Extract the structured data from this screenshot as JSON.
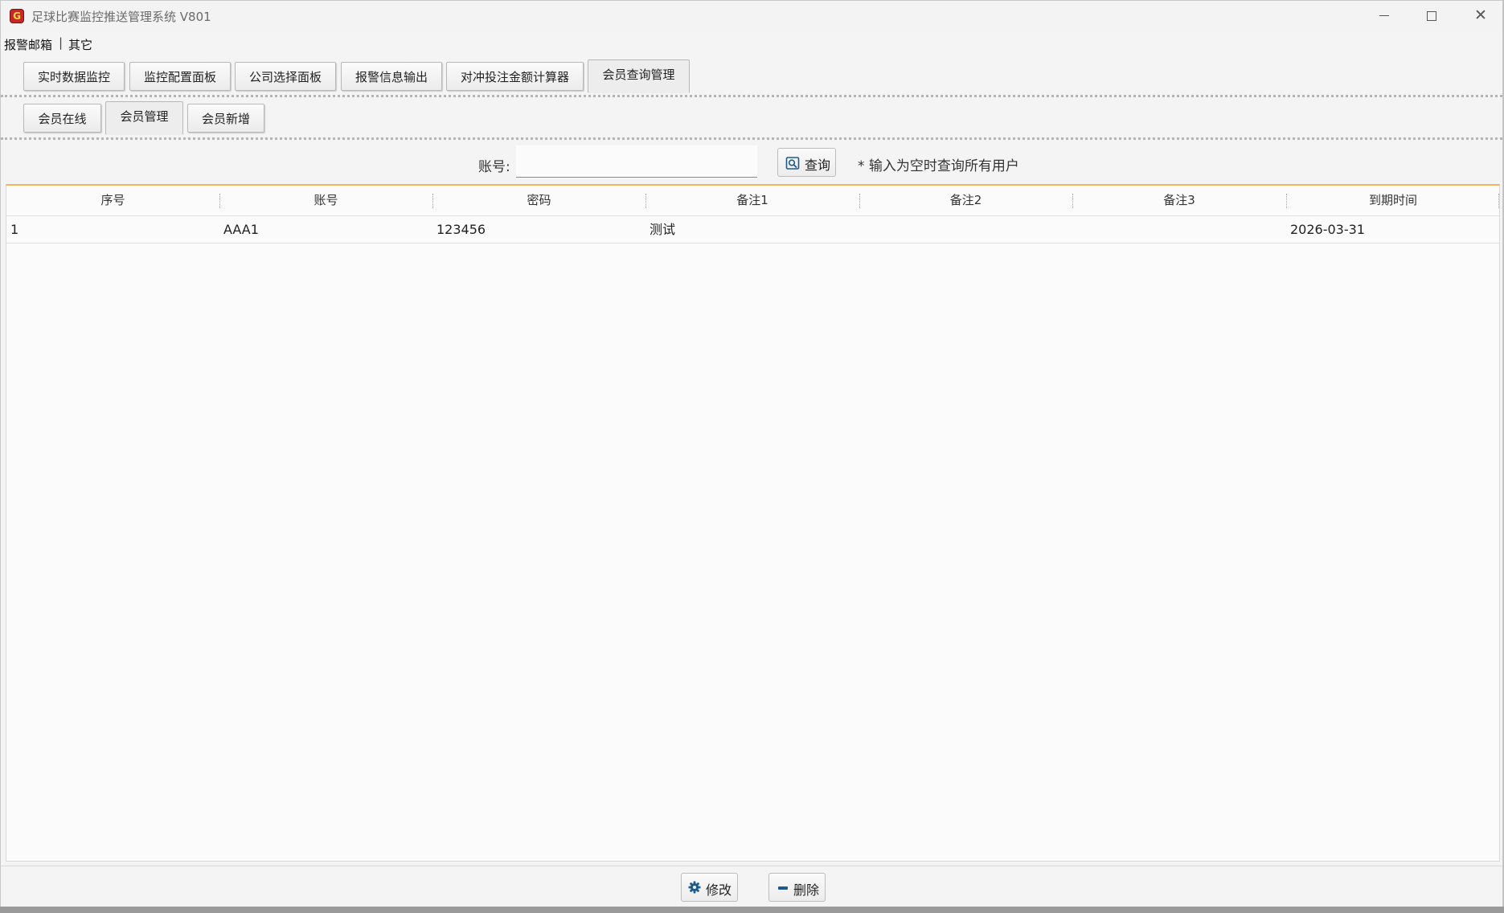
{
  "window": {
    "title": "足球比赛监控推送管理系统 V801",
    "icon": "app-logo-icon",
    "controls": [
      "minimize-icon",
      "maximize-icon",
      "close-icon"
    ]
  },
  "menu": {
    "items": [
      "报警邮箱",
      "其它"
    ],
    "separator": "|"
  },
  "main_tabs": {
    "items": [
      "实时数据监控",
      "监控配置面板",
      "公司选择面板",
      "报警信息输出",
      "对冲投注金额计算器",
      "会员查询管理"
    ],
    "active": "会员查询管理"
  },
  "sub_tabs": {
    "items": [
      "会员在线",
      "会员管理",
      "会员新增"
    ],
    "active": "会员管理"
  },
  "search": {
    "label": "账号:",
    "value": "",
    "button_label": "查询",
    "button_icon": "search-icon",
    "hint": "* 输入为空时查询所有用户"
  },
  "table": {
    "columns": [
      "序号",
      "账号",
      "密码",
      "备注1",
      "备注2",
      "备注3",
      "到期时间"
    ],
    "rows": [
      [
        "1",
        "AAA1",
        "123456",
        "测试",
        "",
        "",
        "2026-03-31"
      ]
    ]
  },
  "footer": {
    "edit_label": "修改",
    "edit_icon": "gear-icon",
    "delete_label": "删除",
    "delete_icon": "minus-icon"
  },
  "colors": {
    "accent": "#f2b45c",
    "icon_blue": "#1e5b8c",
    "app_icon": "#c62828"
  }
}
